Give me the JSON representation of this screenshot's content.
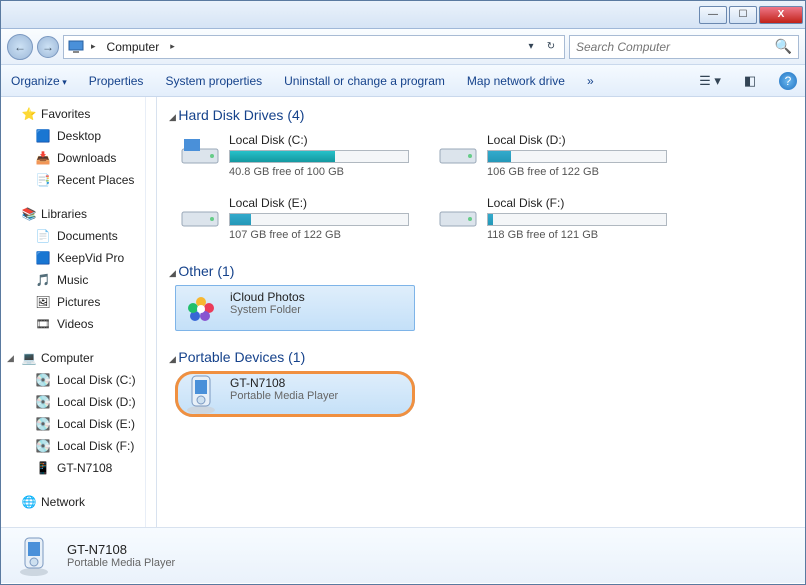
{
  "titlebar": {
    "min": "—",
    "max": "☐",
    "close": "X"
  },
  "nav": {
    "back": "←",
    "fwd": "→"
  },
  "breadcrumb": {
    "root": "Computer"
  },
  "address_tools": {
    "dropdown": "▾",
    "refresh": "↻"
  },
  "search": {
    "placeholder": "Search Computer"
  },
  "toolbar": {
    "organize": "Organize",
    "properties": "Properties",
    "system_properties": "System properties",
    "uninstall": "Uninstall or change a program",
    "map_drive": "Map network drive",
    "more": "»"
  },
  "sidebar": {
    "favorites": {
      "label": "Favorites",
      "items": [
        {
          "label": "Desktop",
          "icon": "🟦"
        },
        {
          "label": "Downloads",
          "icon": "📥"
        },
        {
          "label": "Recent Places",
          "icon": "📑"
        }
      ]
    },
    "libraries": {
      "label": "Libraries",
      "items": [
        {
          "label": "Documents",
          "icon": "📄"
        },
        {
          "label": "KeepVid Pro",
          "icon": "🟦"
        },
        {
          "label": "Music",
          "icon": "🎵"
        },
        {
          "label": "Pictures",
          "icon": "🖼"
        },
        {
          "label": "Videos",
          "icon": "🎞"
        }
      ]
    },
    "computer": {
      "label": "Computer",
      "items": [
        {
          "label": "Local Disk (C:)"
        },
        {
          "label": "Local Disk (D:)"
        },
        {
          "label": "Local Disk (E:)"
        },
        {
          "label": "Local Disk (F:)"
        },
        {
          "label": "GT-N7108"
        }
      ]
    },
    "network": {
      "label": "Network"
    }
  },
  "sections": {
    "drives": {
      "title": "Hard Disk Drives (4)",
      "items": [
        {
          "title": "Local Disk (C:)",
          "free": "40.8 GB free of 100 GB",
          "fill": 59,
          "color": "teal"
        },
        {
          "title": "Local Disk (D:)",
          "free": "106 GB free of 122 GB",
          "fill": 13
        },
        {
          "title": "Local Disk (E:)",
          "free": "107 GB free of 122 GB",
          "fill": 12
        },
        {
          "title": "Local Disk (F:)",
          "free": "118 GB free of 121 GB",
          "fill": 3
        }
      ]
    },
    "other": {
      "title": "Other (1)",
      "items": [
        {
          "title": "iCloud Photos",
          "subtitle": "System Folder"
        }
      ]
    },
    "portable": {
      "title": "Portable Devices (1)",
      "items": [
        {
          "title": "GT-N7108",
          "subtitle": "Portable Media Player"
        }
      ]
    }
  },
  "statusbar": {
    "title": "GT-N7108",
    "subtitle": "Portable Media Player"
  }
}
